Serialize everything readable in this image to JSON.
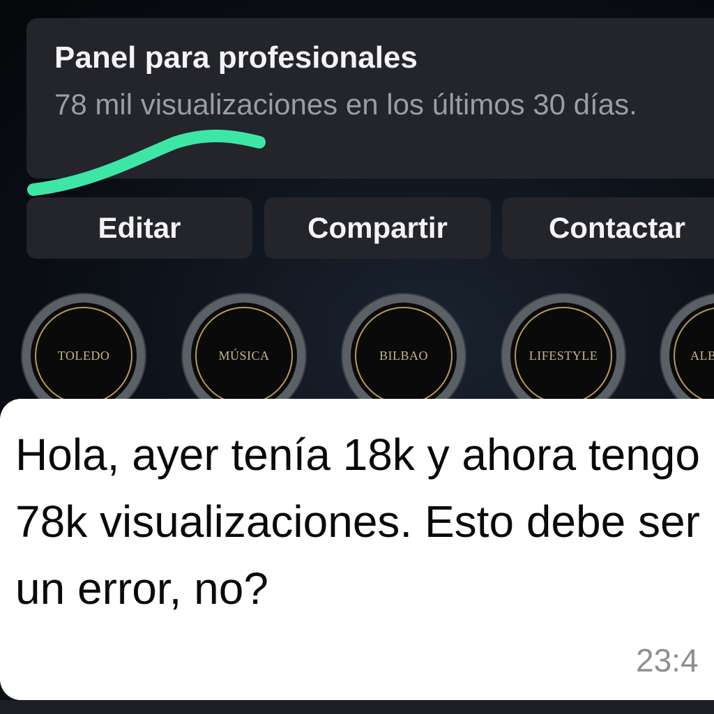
{
  "dashboard": {
    "title": "Panel para profesionales",
    "subtitle": "78 mil visualizaciones en los últimos 30 días.",
    "highlight_color": "#3ee6a6"
  },
  "buttons": {
    "edit": "Editar",
    "share": "Compartir",
    "contact": "Contactar"
  },
  "highlights": [
    {
      "label": "TOLEDO"
    },
    {
      "label": "MÚSICA"
    },
    {
      "label": "BILBAO"
    },
    {
      "label": "LIFESTYLE"
    },
    {
      "label": "ALB"
    }
  ],
  "message": {
    "text": "Hola, ayer tenía 18k y ahora tengo 78k visualizaciones. Esto debe ser un error, no?",
    "time": "23:4"
  }
}
